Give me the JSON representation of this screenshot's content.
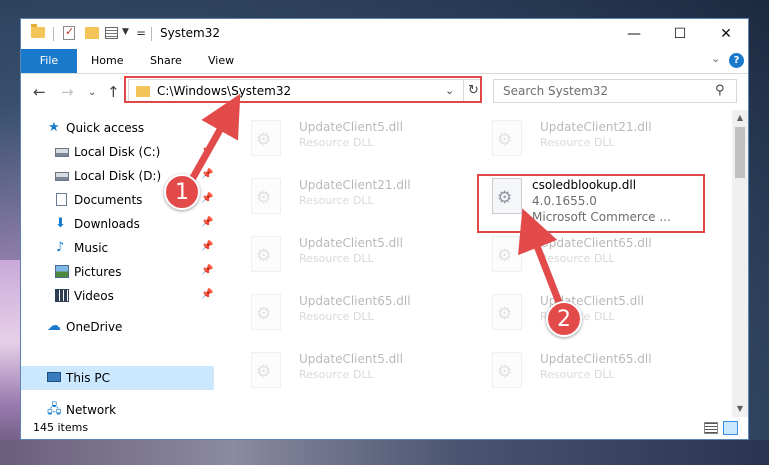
{
  "window": {
    "title": "System32",
    "controls": {
      "minimize": "—",
      "maximize": "☐",
      "close": "✕"
    }
  },
  "ribbon": {
    "file_tab": "File",
    "tabs": [
      "Home",
      "Share",
      "View"
    ],
    "help": "?"
  },
  "nav": {
    "address_path": "C:\\Windows\\System32",
    "search_placeholder": "Search System32"
  },
  "sidebar": {
    "items": [
      {
        "label": "Quick access",
        "icon": "star-icon"
      },
      {
        "label": "Local Disk (C:)",
        "icon": "disk-icon",
        "pinned": true
      },
      {
        "label": "Local Disk (D:)",
        "icon": "disk-icon",
        "pinned": true
      },
      {
        "label": "Documents",
        "icon": "documents-icon",
        "pinned": true
      },
      {
        "label": "Downloads",
        "icon": "downloads-icon",
        "pinned": true
      },
      {
        "label": "Music",
        "icon": "music-icon",
        "pinned": true
      },
      {
        "label": "Pictures",
        "icon": "pictures-icon",
        "pinned": true
      },
      {
        "label": "Videos",
        "icon": "videos-icon",
        "pinned": true
      },
      {
        "label": "OneDrive",
        "icon": "cloud-icon"
      },
      {
        "label": "This PC",
        "icon": "computer-icon",
        "selected": true
      },
      {
        "label": "Network",
        "icon": "network-icon"
      }
    ]
  },
  "files": {
    "col1": [
      {
        "name": "UpdateClient5.dll",
        "desc": "Resource DLL"
      },
      {
        "name": "UpdateClient21.dll",
        "desc": "Resource DLL"
      },
      {
        "name": "UpdateClient5.dll",
        "desc": "Resource DLL"
      },
      {
        "name": "UpdateClient65.dll",
        "desc": "Resource DLL"
      },
      {
        "name": "UpdateClient5.dll",
        "desc": "Resource DLL"
      }
    ],
    "col2": [
      {
        "name": "UpdateClient21.dll",
        "desc": "Resource DLL"
      },
      {
        "name": "UpdateClient65.dll",
        "desc": "Resource DLL"
      },
      {
        "name": "UpdateClient5.dll",
        "desc": "Resource DLL"
      },
      {
        "name": "UpdateClient65.dll",
        "desc": "Resource DLL"
      }
    ],
    "featured": {
      "name": "csoledblookup.dll",
      "version": "4.0.1655.0",
      "company": "Microsoft Commerce ..."
    }
  },
  "status": {
    "item_count": "145 items"
  },
  "annotations": {
    "step1": "1",
    "step2": "2",
    "color": "#e34b4b"
  }
}
